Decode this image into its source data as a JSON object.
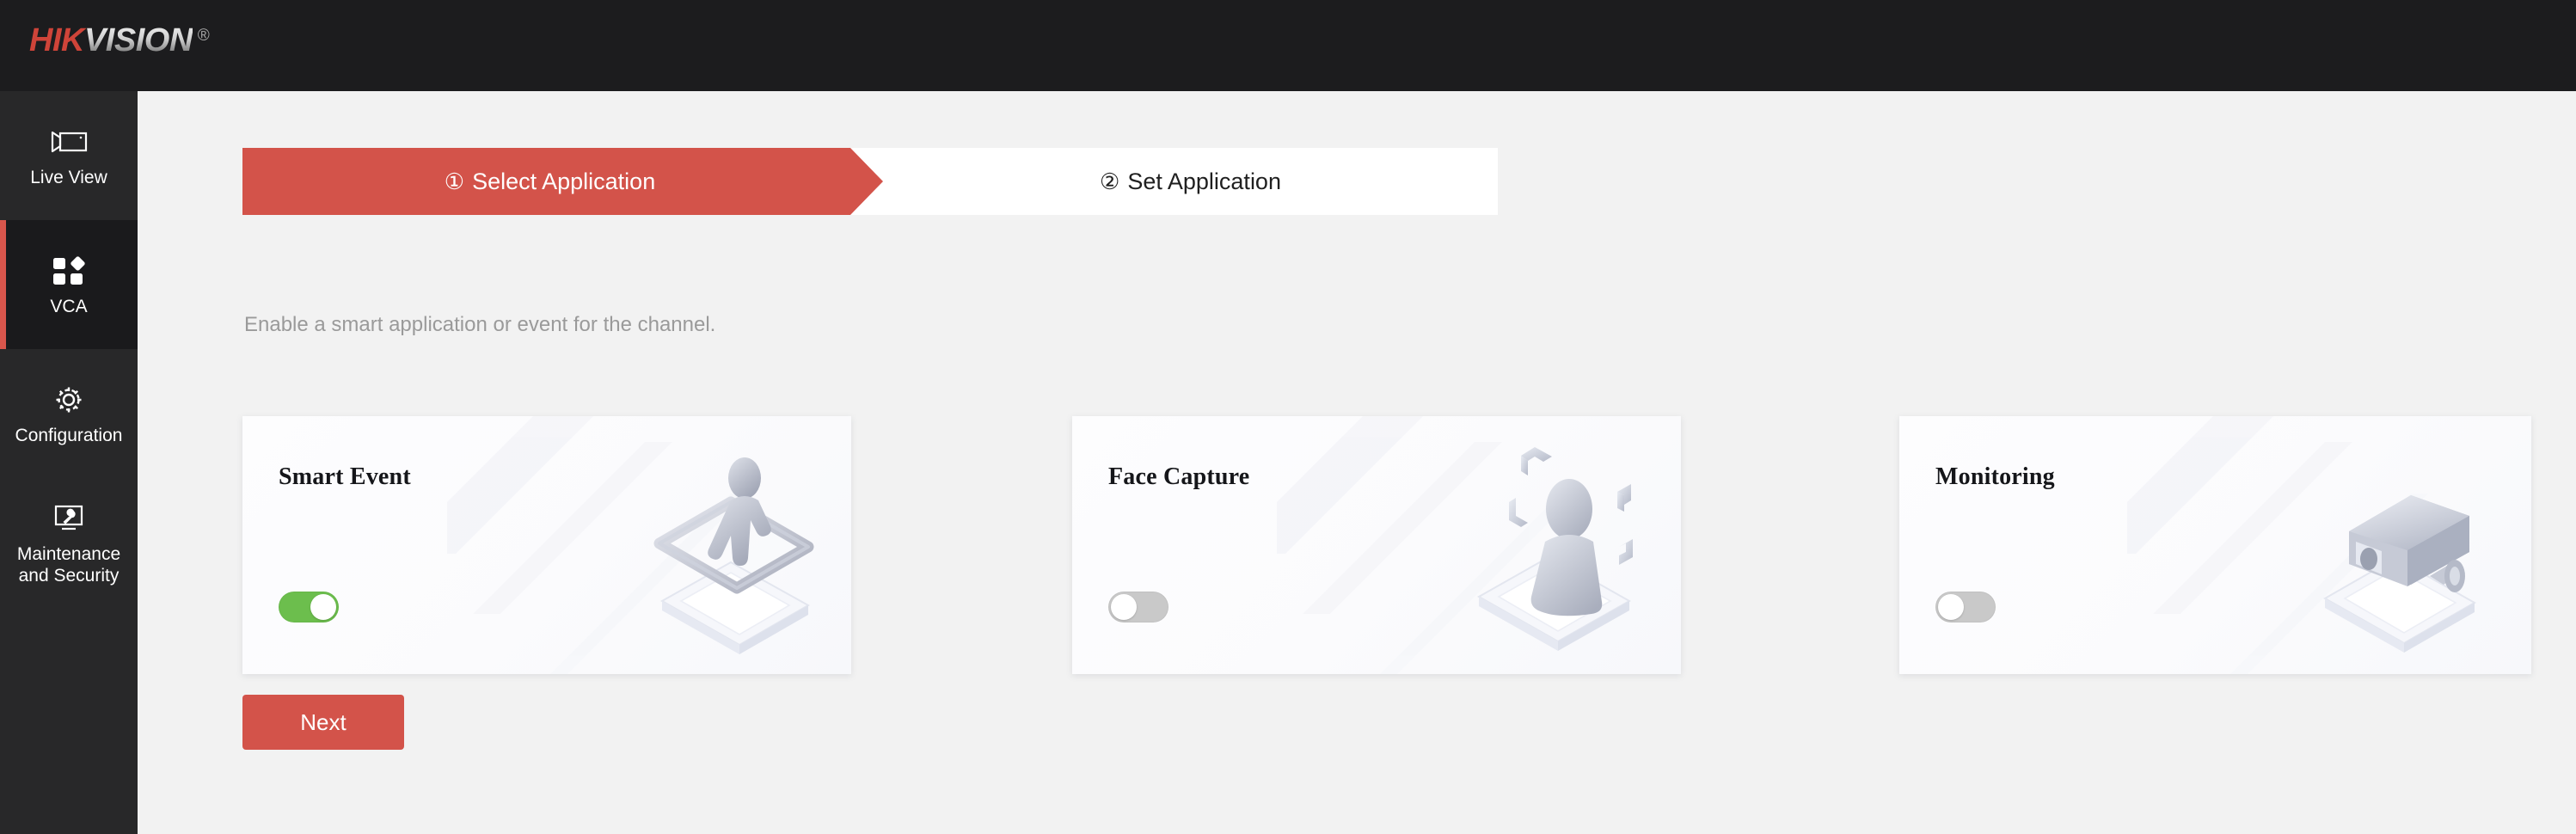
{
  "brand": {
    "name_primary": "HIK",
    "name_secondary": "VISION",
    "registered_mark": "®"
  },
  "sidebar": {
    "items": [
      {
        "label": "Live View",
        "icon": "camcorder-icon",
        "active": false
      },
      {
        "label": "VCA",
        "icon": "grid-apps-icon",
        "active": true
      },
      {
        "label": "Configuration",
        "icon": "gear-icon",
        "active": false
      },
      {
        "label": "Maintenance\nand Security",
        "icon": "wrench-box-icon",
        "active": false
      }
    ]
  },
  "wizard": {
    "steps": [
      {
        "number": "①",
        "label": "Select Application",
        "active": true
      },
      {
        "number": "②",
        "label": "Set Application",
        "active": false
      }
    ],
    "hint": "Enable a smart application or event for the channel.",
    "next_label": "Next"
  },
  "applications": [
    {
      "title": "Smart Event",
      "enabled": true,
      "illustration": "person-on-platform-icon"
    },
    {
      "title": "Face Capture",
      "enabled": false,
      "illustration": "face-brackets-icon"
    },
    {
      "title": "Monitoring",
      "enabled": false,
      "illustration": "cctv-camera-icon"
    }
  ],
  "colors": {
    "accent_red": "#d3534a",
    "toggle_on_green": "#6cbe4d",
    "toggle_off_gray": "#c9c9c9",
    "header_dark": "#1c1c1e",
    "sidebar_dark": "#282829",
    "page_bg": "#f2f2f2"
  }
}
